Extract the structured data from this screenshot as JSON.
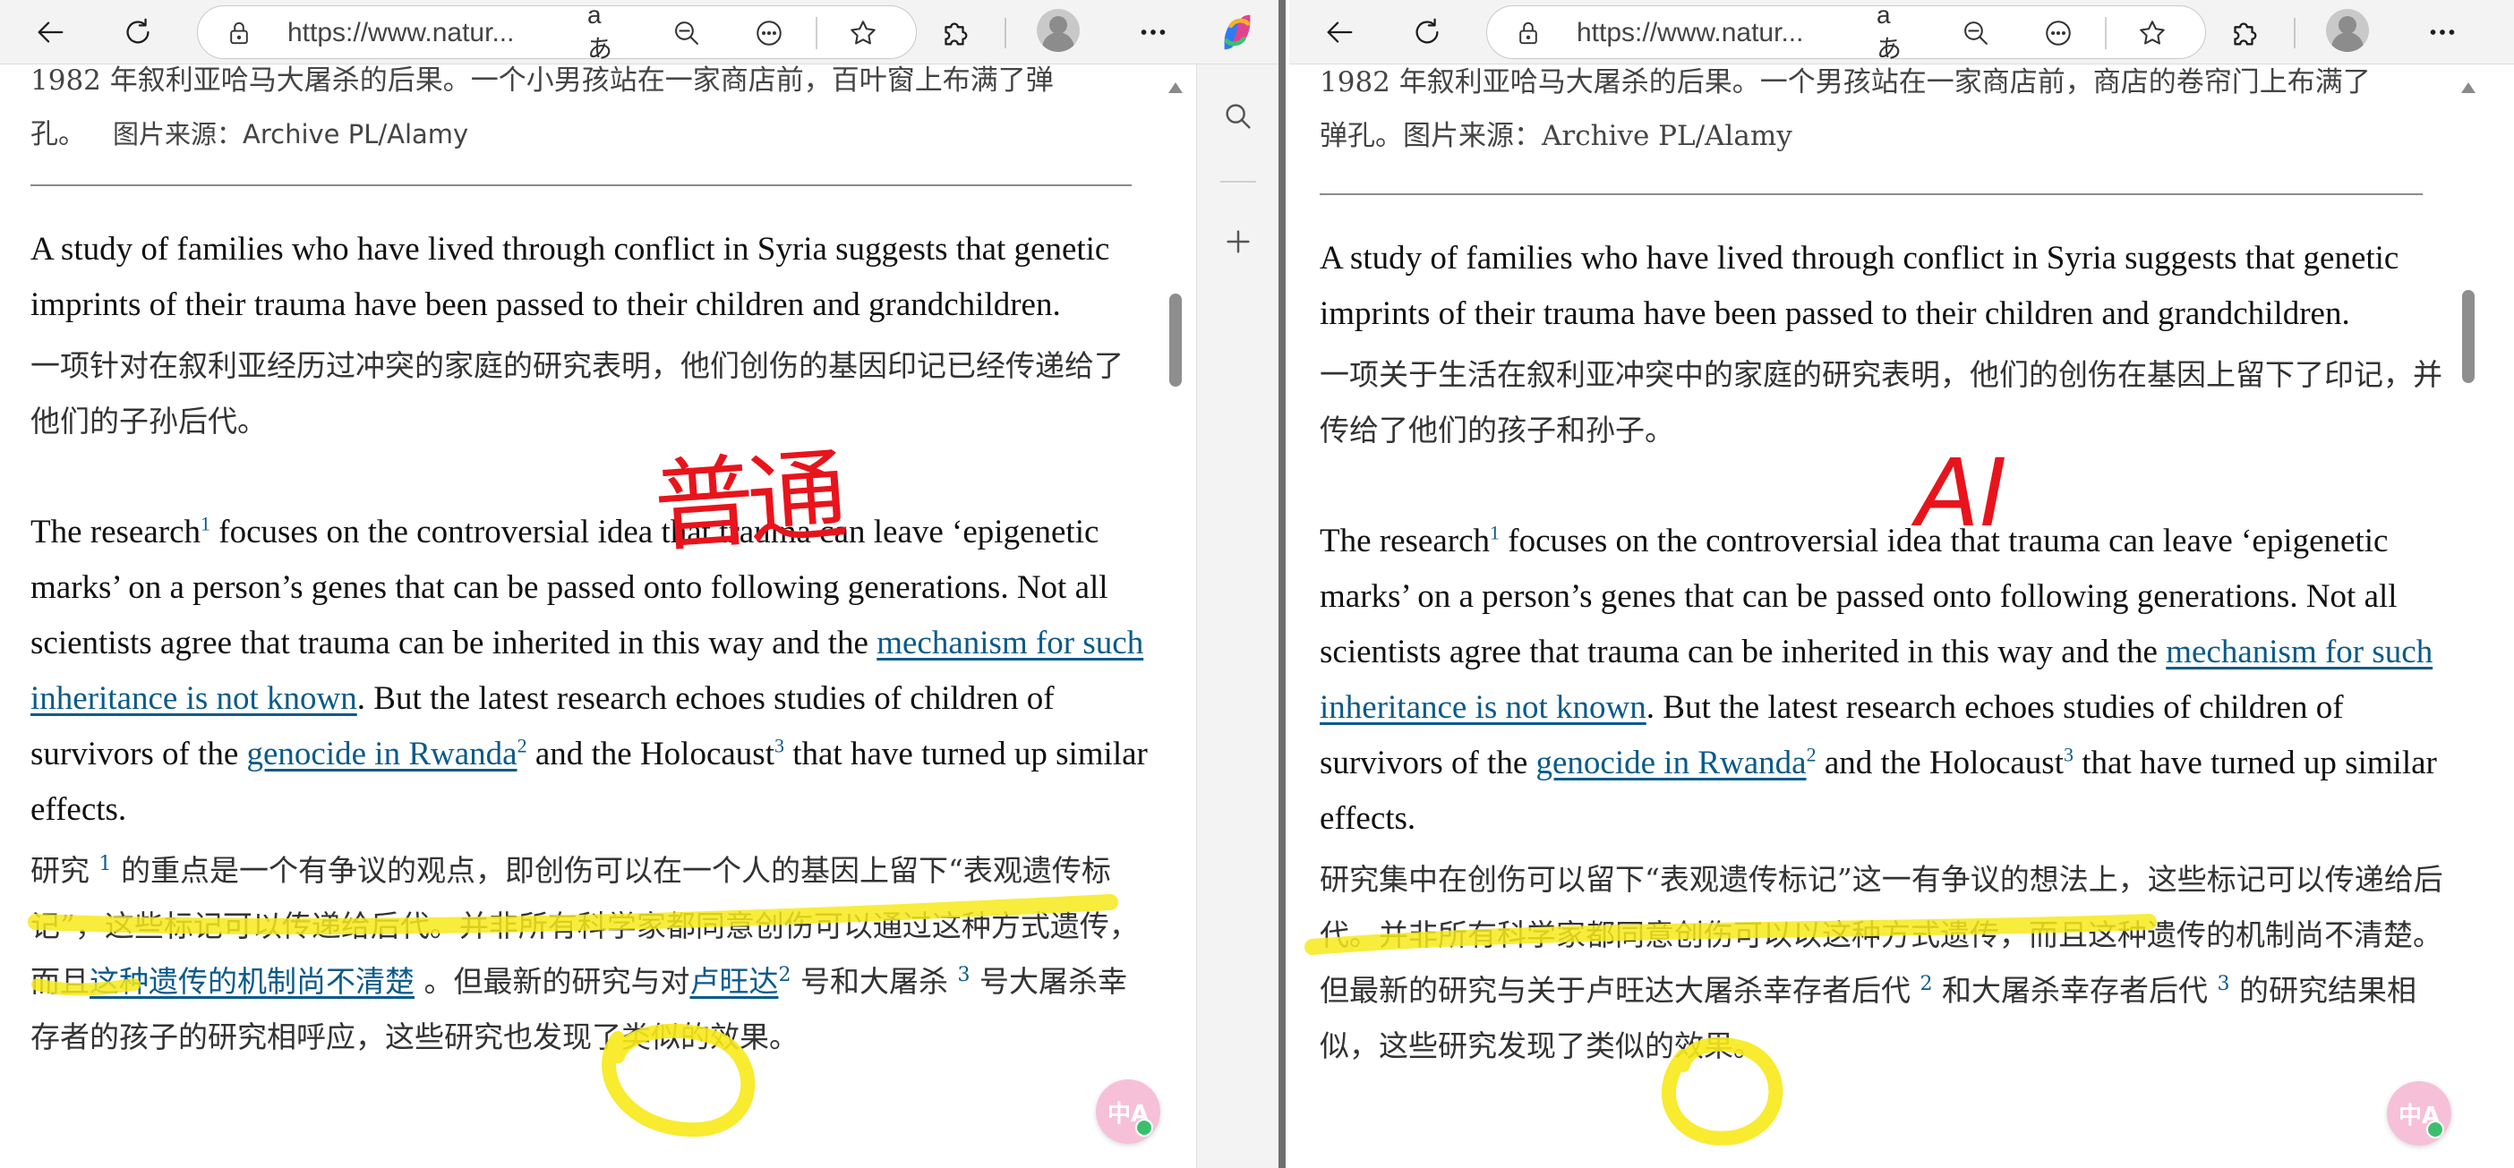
{
  "browser": {
    "url": "https://www.natur...",
    "read_aloud_label": "aあ",
    "icons": [
      "back-icon",
      "refresh-icon",
      "lock-icon",
      "read-aloud-icon",
      "zoom-out-icon",
      "more-icon",
      "favorite-icon",
      "extensions-icon",
      "profile-icon",
      "menu-icon",
      "copilot-icon",
      "search-icon",
      "add-icon"
    ]
  },
  "left": {
    "caption_line1": "1982 年叙利亚哈马大屠杀的后果。一个小男孩站在一家商店前，百叶窗上布满了弹",
    "caption_line2": "孔。",
    "caption_source": "图片来源：Archive PL/Alamy",
    "p1_en": "A study of families who have lived through conflict in Syria suggests that genetic imprints of their trauma have been passed to their children and grandchildren.",
    "p1_cn": "一项针对在叙利亚经历过冲突的家庭的研究表明，他们创伤的基因印记已经传递给了他们的子孙后代。",
    "p2_en_a": "The research",
    "p2_en_sup1": "1",
    "p2_en_b": " focuses on the controversial idea that trauma can leave ‘epigenetic marks’ on a person’s genes that can be passed onto following generations. Not all scientists agree that trauma can be inherited in this way and the ",
    "p2_en_link1": "mechanism for such inheritance is not known",
    "p2_en_c": ". But the latest research echoes studies of children of survivors of the ",
    "p2_en_link2": "genocide in Rwanda",
    "p2_en_sup2": "2",
    "p2_en_d": " and the Holocaust",
    "p2_en_sup3": "3",
    "p2_en_e": " that have turned up similar effects.",
    "p2_cn_a": "研究 ",
    "p2_cn_sup1": "1",
    "p2_cn_b": " 的重点是一个有争议的观点，即创伤可以在一个人的基因上留下“表观遗传标记”，这些标记可以传递给后代。并非所有科学家都同意创伤可以通过这种方式遗传，而且",
    "p2_cn_link1": "这种遗传的机制尚不清楚",
    "p2_cn_c": " 。但最新的研究与对",
    "p2_cn_link2": "卢旺达",
    "p2_cn_sup2": "2",
    "p2_cn_d": " 号和大屠杀 ",
    "p2_cn_sup3": "3",
    "p2_cn_e": " 号大屠杀幸存者的孩子的研究相呼应，这些研究也发现了类似的效果。",
    "annotation_label": "普通"
  },
  "right": {
    "caption_line1": "1982 年叙利亚哈马大屠杀的后果。一个男孩站在一家商店前，商店的卷帘门上布满了",
    "caption_line2": "弹孔。图片来源：Archive PL/Alamy",
    "p1_en": "A study of families who have lived through conflict in Syria suggests that genetic imprints of their trauma have been passed to their children and grandchildren.",
    "p1_cn": "一项关于生活在叙利亚冲突中的家庭的研究表明，他们的创伤在基因上留下了印记，并传给了他们的孩子和孙子。",
    "p2_en_a": "The research",
    "p2_en_sup1": "1",
    "p2_en_b": " focuses on the controversial idea that trauma can leave ‘epigenetic marks’ on a person’s genes that can be passed onto following generations. Not all scientists agree that trauma can be inherited in this way and the ",
    "p2_en_link1": "mechanism for such inheritance is not known",
    "p2_en_c": ". But the latest research echoes studies of children of survivors of the ",
    "p2_en_link2": "genocide in Rwanda",
    "p2_en_sup2": "2",
    "p2_en_d": " and the Holocaust",
    "p2_en_sup3": "3",
    "p2_en_e": " that have turned up similar effects.",
    "p2_cn_a": "研究集中在创伤可以留下“表观遗传标记”这一有争议的想法上，这些标记可以传递给后代。并非所有科学家都同意创伤可以以这种方式遗传，而且这种遗传的机制尚不清楚。但最新的研究与关于卢旺达大屠杀幸存者后代 ",
    "p2_cn_sup2": "2",
    "p2_cn_b": " 和大屠杀幸存者后代 ",
    "p2_cn_sup3": "3",
    "p2_cn_c": " 的研究结果相似，这些研究发现了类似的效果。",
    "annotation_label": "AI"
  },
  "translate_button_label": "中A",
  "colors": {
    "link": "#0b5a8a",
    "annotation_red": "#e8141c",
    "highlight_yellow": "#f7e91a"
  }
}
